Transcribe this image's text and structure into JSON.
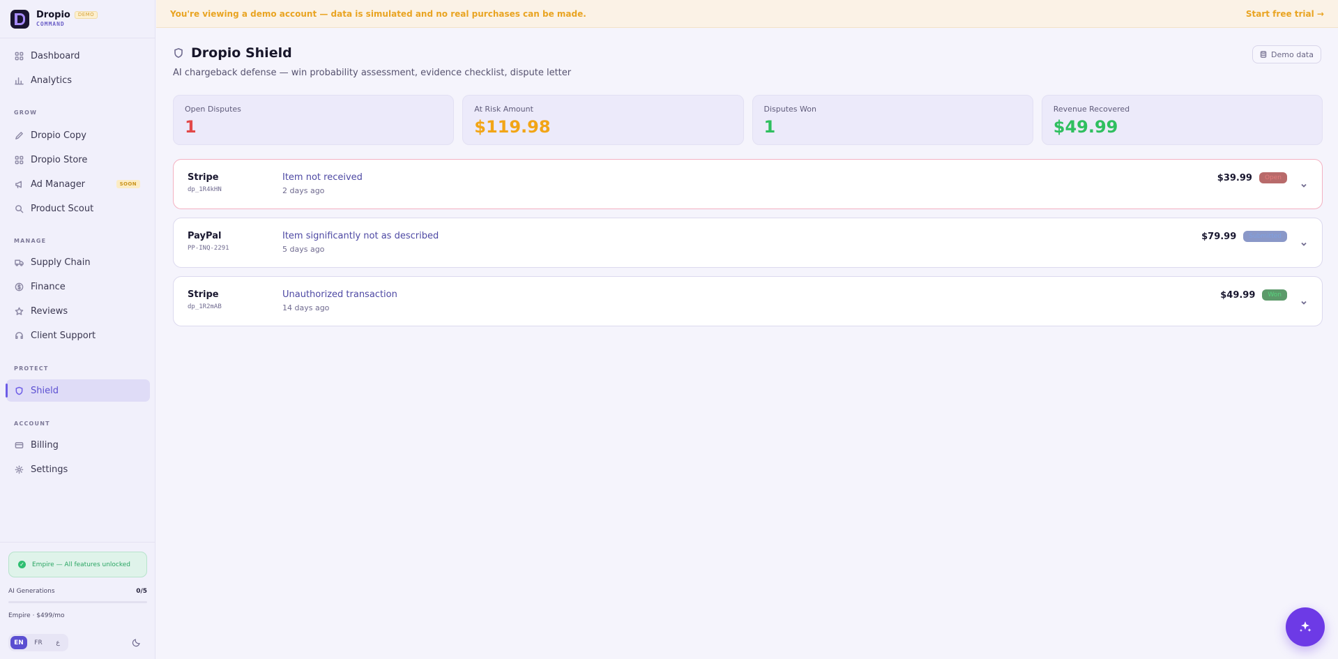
{
  "brand": {
    "name": "Dropio",
    "badge": "DEMO",
    "subtitle": "COMMAND"
  },
  "nav": {
    "dashboard": "Dashboard",
    "analytics": "Analytics",
    "grow_label": "GROW",
    "dropio_copy": "Dropio Copy",
    "dropio_store": "Dropio Store",
    "ad_manager": "Ad Manager",
    "ad_manager_badge": "SOON",
    "product_scout": "Product Scout",
    "manage_label": "MANAGE",
    "supply_chain": "Supply Chain",
    "finance": "Finance",
    "reviews": "Reviews",
    "client_support": "Client Support",
    "protect_label": "PROTECT",
    "shield": "Shield",
    "account_label": "ACCOUNT",
    "billing": "Billing",
    "settings": "Settings"
  },
  "plan": {
    "status": "Empire — All features unlocked",
    "generations_label": "AI Generations",
    "generations_count": "0/5",
    "generations_used_fraction": 0,
    "price": "Empire · $499/mo"
  },
  "languages": {
    "en": "EN",
    "fr": "FR",
    "ar": "ع"
  },
  "banner": {
    "text": "You're viewing a demo account — data is simulated and no real purchases can be made.",
    "cta": "Start free trial →"
  },
  "page": {
    "title": "Dropio Shield",
    "subtitle": "AI chargeback defense — win probability assessment, evidence checklist, dispute letter",
    "demo_button": "Demo data"
  },
  "stats": [
    {
      "label": "Open Disputes",
      "value": "1",
      "color": "#e24848"
    },
    {
      "label": "At Risk Amount",
      "value": "$119.98",
      "color": "#f2a516"
    },
    {
      "label": "Disputes Won",
      "value": "1",
      "color": "#2fbf5f"
    },
    {
      "label": "Revenue Recovered",
      "value": "$49.99",
      "color": "#2fbf5f"
    }
  ],
  "disputes": [
    {
      "provider": "Stripe",
      "id": "dp_1R4kHN",
      "reason": "Item not received",
      "age": "2 days ago",
      "amount": "$39.99",
      "status": "Open"
    },
    {
      "provider": "PayPal",
      "id": "PP-INQ-2291",
      "reason": "Item significantly not as described",
      "age": "5 days ago",
      "amount": "$79.99",
      "status": "Submitted"
    },
    {
      "provider": "Stripe",
      "id": "dp_1R2mAB",
      "reason": "Unauthorized transaction",
      "age": "14 days ago",
      "amount": "$49.99",
      "status": "Won"
    }
  ]
}
